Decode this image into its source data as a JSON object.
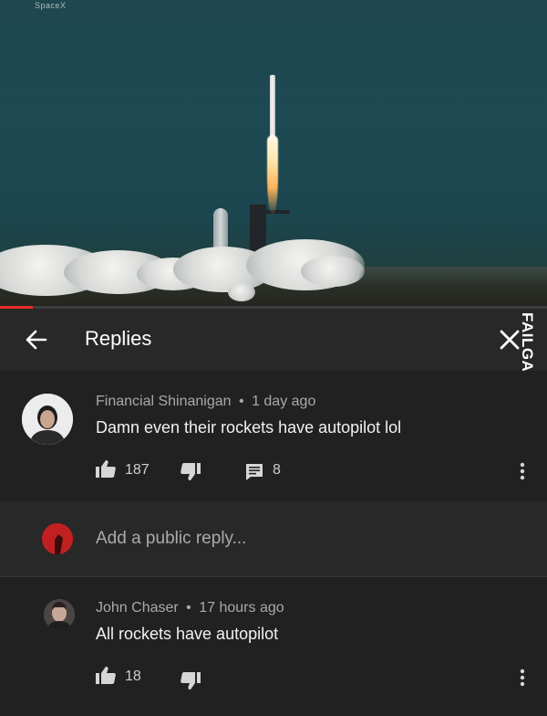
{
  "video": {
    "watermark": "SpaceX",
    "progress_fraction": 0.06,
    "accent_color": "#e52d27"
  },
  "header": {
    "title": "Replies",
    "back_icon": "arrow-left-icon",
    "close_icon": "close-icon"
  },
  "watermark_side": "FAILGAGS.COM",
  "comment": {
    "author": "Financial Shinanigan",
    "separator": "•",
    "time": "1 day ago",
    "text": "Damn even their rockets have autopilot lol",
    "likes": "187",
    "replies": "8"
  },
  "reply_box": {
    "placeholder": "Add a public reply..."
  },
  "reply": {
    "author": "John Chaser",
    "separator": "•",
    "time": "17 hours ago",
    "text": "All rockets have autopilot",
    "likes": "18"
  }
}
